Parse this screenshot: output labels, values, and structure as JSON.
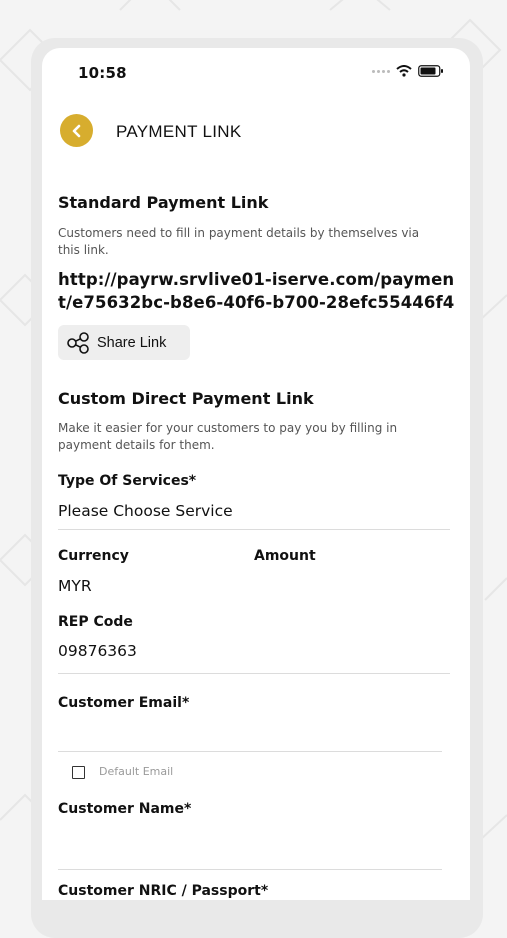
{
  "status_bar": {
    "time": "10:58"
  },
  "header": {
    "title": "PAYMENT LINK"
  },
  "standard": {
    "heading": "Standard Payment Link",
    "description": "Customers need to fill in payment details  by themselves via this link.",
    "url": "http://payrw.srvlive01-iserve.com/payment/e75632bc-b8e6-40f6-b700-28efc55446f4",
    "share_label": "Share Link"
  },
  "custom": {
    "heading": "Custom Direct Payment Link",
    "description": "Make it easier for your customers to pay you by filling in payment details for them."
  },
  "form": {
    "service_label": "Type Of Services*",
    "service_value": "Please Choose Service",
    "currency_label": "Currency",
    "currency_value": "MYR",
    "amount_label": "Amount",
    "amount_value": "",
    "rep_label": "REP Code",
    "rep_value": "09876363",
    "email_label": "Customer Email*",
    "email_value": "",
    "default_email_label": "Default Email",
    "default_email_checked": false,
    "name_label": "Customer Name*",
    "name_value": "",
    "nric_label": "Customer NRIC / Passport*"
  },
  "colors": {
    "accent": "#d7ad2e",
    "button_bg": "#eeeeee",
    "divider": "#dcdcdc"
  }
}
